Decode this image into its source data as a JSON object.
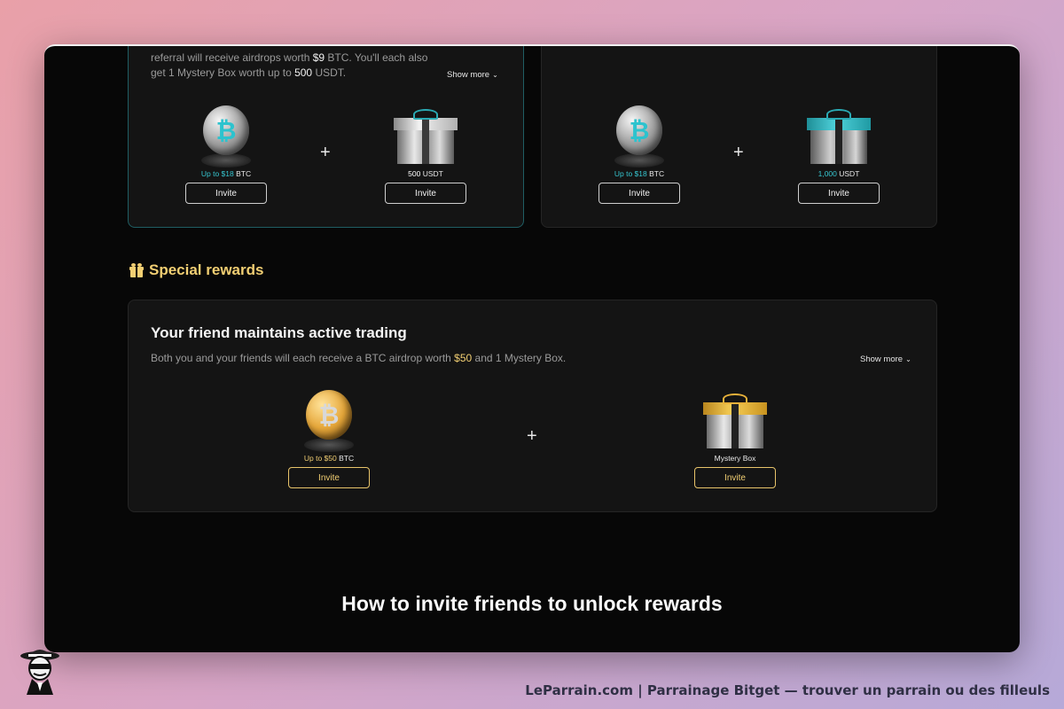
{
  "top_left_card": {
    "desc_part1": "referral will receive airdrops worth ",
    "desc_amount": "$9",
    "desc_part2": " BTC. You'll each also",
    "desc_line2_part1": "get 1 Mystery Box worth up to ",
    "desc_line2_amount": "500",
    "desc_line2_part2": " USDT.",
    "show_more": "Show more",
    "reward1": {
      "amount": "Up to $18",
      "unit": " BTC",
      "invite": "Invite"
    },
    "reward2": {
      "amount": "500",
      "unit": " USDT",
      "invite": "Invite"
    }
  },
  "top_right_card": {
    "reward1": {
      "amount": "Up to $18",
      "unit": " BTC",
      "invite": "Invite"
    },
    "reward2": {
      "amount": "1,000",
      "unit": " USDT",
      "invite": "Invite"
    }
  },
  "special": {
    "section_title": "Special rewards",
    "card_title": "Your friend maintains active trading",
    "desc_part1": "Both you and your friends will each receive a BTC airdrop worth ",
    "desc_amount": "$50",
    "desc_part2": " and 1 Mystery Box.",
    "show_more": "Show more",
    "reward1": {
      "amount": "Up to $50",
      "unit": " BTC",
      "invite": "Invite"
    },
    "reward2": {
      "label": "Mystery Box",
      "invite": "Invite"
    }
  },
  "how_title": "How to invite friends to unlock rewards",
  "plus_sign": "+",
  "icons": {
    "coin": "bitcoin-coin-icon",
    "gift": "gift-box-icon",
    "section": "gift-icon",
    "chevron": "chevron-down-icon"
  },
  "footer": "LeParrain.com | Parrainage Bitget — trouver un parrain ou des filleuls",
  "colors": {
    "accent_gold": "#f2cf73",
    "accent_teal": "#36c6d0",
    "background": "#070707"
  }
}
